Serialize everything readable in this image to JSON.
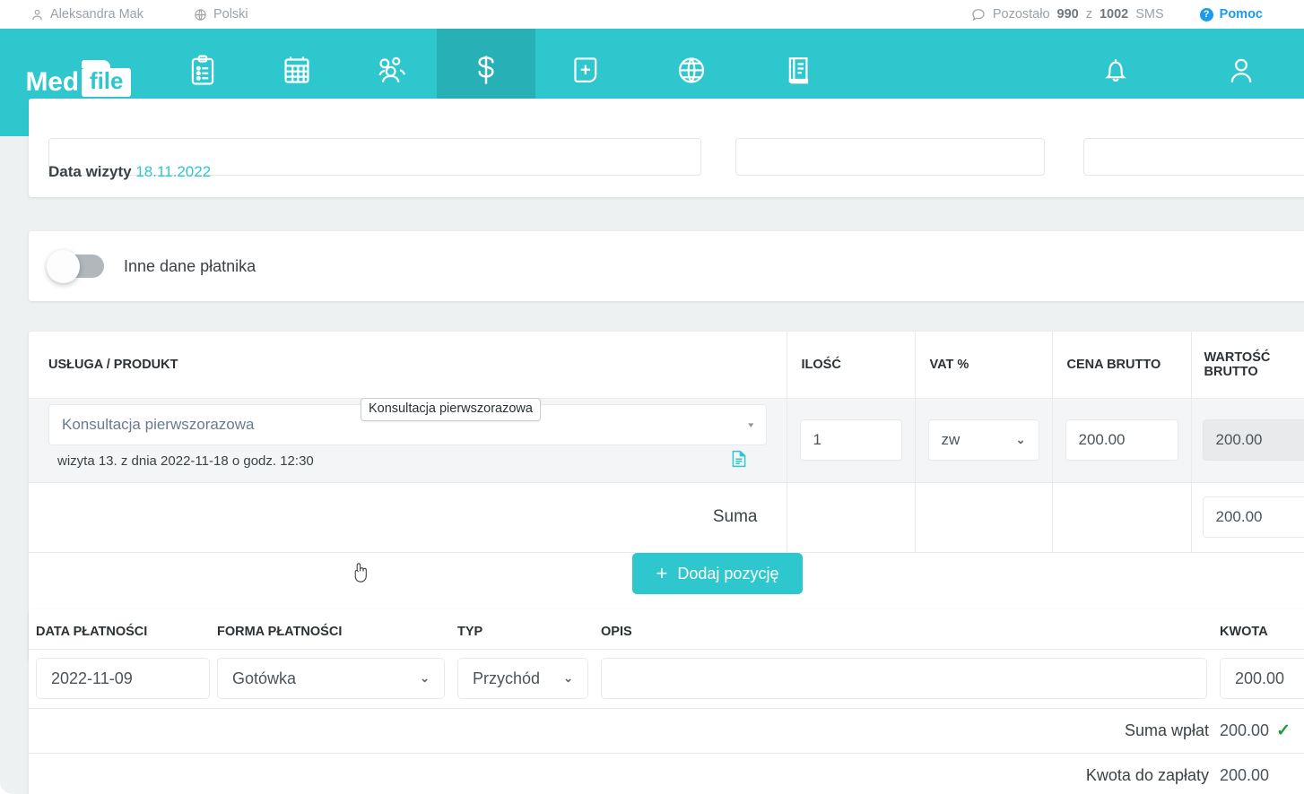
{
  "topbar": {
    "user": "Aleksandra Mak",
    "language": "Polski",
    "sms_prefix": "Pozostało",
    "sms_remaining": "990",
    "sms_middle": "z",
    "sms_total": "1002",
    "sms_suffix": "SMS",
    "help": "Pomoc",
    "help_badge": "?"
  },
  "nav": {
    "logo_primary": "Med",
    "logo_secondary": "file",
    "items": [
      {
        "label": "Wizyty",
        "icon": "clipboard-icon",
        "active": false
      },
      {
        "label": "Kalendarz",
        "icon": "calendar-icon",
        "active": false
      },
      {
        "label": "Pacjenci",
        "icon": "people-icon",
        "active": false
      },
      {
        "label": "Rachunki",
        "icon": "dollar-icon",
        "active": true
      },
      {
        "label": "e-Zdrowie",
        "icon": "health-card-icon",
        "active": false
      },
      {
        "label": "Strona WWW",
        "icon": "globe-icon",
        "active": false
      },
      {
        "label": "Instrukcje",
        "icon": "book-icon",
        "active": false
      }
    ],
    "right_items": [
      {
        "label": "Powiadomienia",
        "icon": "bell-icon"
      },
      {
        "label": "Moje konto",
        "icon": "user-icon"
      }
    ],
    "accent_color": "#2ec7cd",
    "active_color": "#27b0b6"
  },
  "visit": {
    "date_label": "Data wizyty",
    "date_value": "18.11.2022"
  },
  "payer": {
    "toggle_label": "Inne dane płatnika",
    "toggle_on": false
  },
  "items_table": {
    "headers": {
      "service": "USŁUGA / PRODUKT",
      "qty": "ILOŚĆ",
      "vat": "VAT %",
      "price_gross": "CENA BRUTTO",
      "value_gross_line1": "WARTOŚĆ",
      "value_gross_line2": "BRUTTO"
    },
    "rows": [
      {
        "service": "Konsultacja pierwszorazowa",
        "sub": "wizyta 13. z dnia 2022-11-18 o godz. 12:30",
        "sub_icon": "document-icon",
        "qty": "1",
        "vat": "zw",
        "price_gross": "200.00",
        "value_gross": "200.00"
      }
    ],
    "sum_label": "Suma",
    "sum_value": "200.00"
  },
  "tooltip": {
    "text": "Konsultacja pierwszorazowa"
  },
  "add_button": {
    "label": "Dodaj pozycję",
    "icon": "plus-icon"
  },
  "payments_table": {
    "headers": {
      "date": "DATA PŁATNOŚCI",
      "form": "FORMA PŁATNOŚCI",
      "type": "TYP",
      "description": "OPIS",
      "amount": "KWOTA"
    },
    "rows": [
      {
        "date": "2022-11-09",
        "form": "Gotówka",
        "type": "Przychód",
        "description": "",
        "amount": "200.00"
      }
    ],
    "totals": [
      {
        "label": "Suma wpłat",
        "value": "200.00",
        "check": "✓"
      },
      {
        "label": "Kwota do zapłaty",
        "value": "200.00",
        "check": ""
      }
    ]
  }
}
